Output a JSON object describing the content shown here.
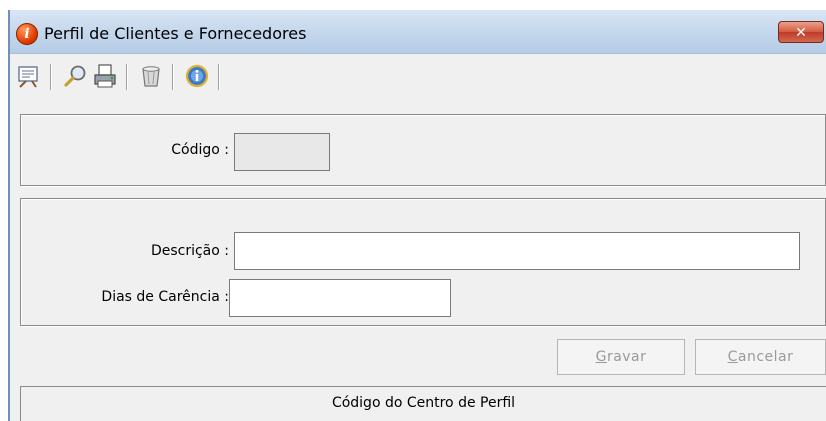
{
  "window": {
    "title": "Perfil de Clientes e Fornecedores",
    "close_symbol": "✕"
  },
  "toolbar": {
    "items": [
      "new-record-icon",
      "search-icon",
      "print-icon",
      "delete-icon",
      "help-icon"
    ]
  },
  "form": {
    "codigo_label": "Código :",
    "codigo_value": "",
    "descricao_label": "Descrição :",
    "descricao_value": "",
    "dias_label": "Dias de Carência :",
    "dias_value": ""
  },
  "buttons": {
    "gravar_hotkey": "G",
    "gravar_rest": "ravar",
    "cancelar_hotkey": "C",
    "cancelar_rest": "ancelar"
  },
  "status": {
    "text": "Código do Centro de Perfil"
  },
  "colors": {
    "titlebar": "#c3d6ec",
    "close": "#c0392b",
    "window_bg": "#f0f0f0"
  }
}
